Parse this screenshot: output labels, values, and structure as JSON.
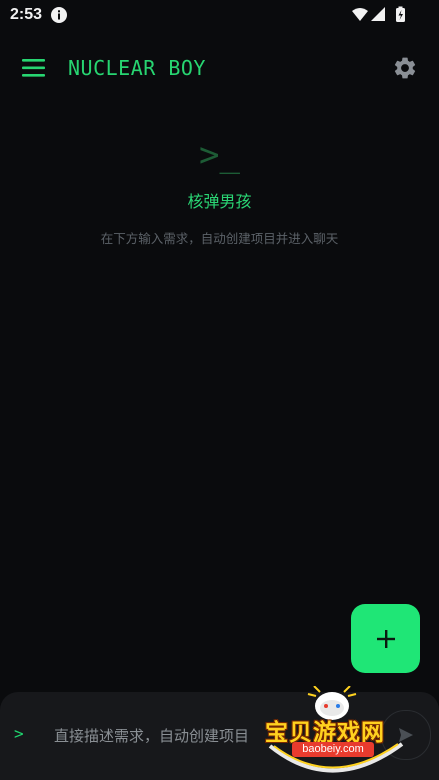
{
  "status_bar": {
    "time": "2:53"
  },
  "app_bar": {
    "title": "NUCLEAR BOY"
  },
  "empty_state": {
    "prompt_glyph": ">_",
    "title": "核弹男孩",
    "hint": "在下方输入需求，自动创建项目并进入聊天"
  },
  "fab": {
    "icon": "plus-icon"
  },
  "input": {
    "caret": ">",
    "placeholder": "直接描述需求，自动创建项目",
    "value": ""
  },
  "watermark": {
    "title": "宝贝游戏网",
    "url": "baobeiy.com"
  },
  "colors": {
    "accent": "#1fe676",
    "background": "#0a0b0d",
    "panel": "#17181b"
  }
}
